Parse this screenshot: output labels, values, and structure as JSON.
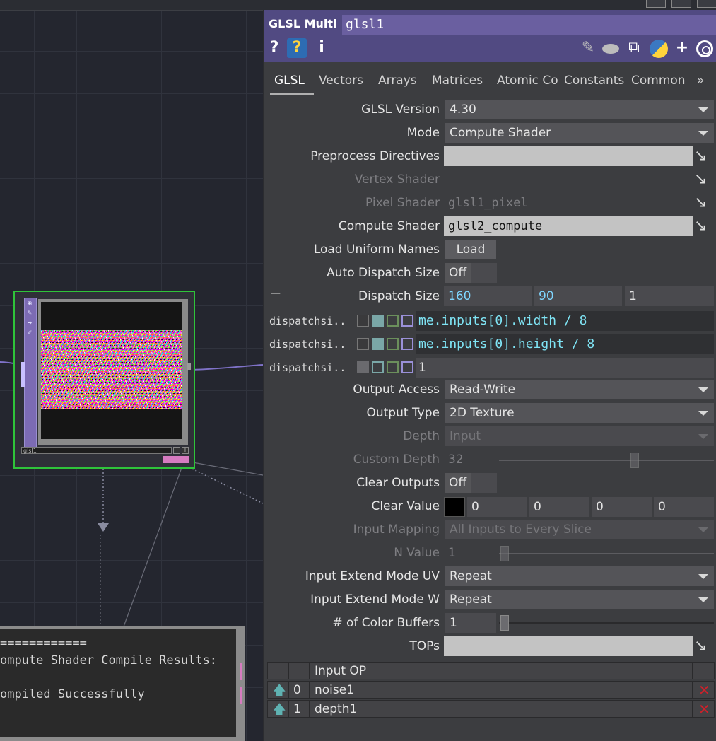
{
  "window_controls": [
    "minimize",
    "restore",
    "menu"
  ],
  "node": {
    "name": "glsl1"
  },
  "textport": {
    "lines": [
      "============",
      "ompute Shader Compile Results:",
      "",
      "ompiled Successfully"
    ]
  },
  "header": {
    "op_type": "GLSL Multi",
    "op_name": "glsl1",
    "icons": [
      "help-icon",
      "python-help-icon",
      "info-icon",
      "edit-icon",
      "comment-icon",
      "clone-icon",
      "python-icon",
      "add-icon",
      "viewer-icon"
    ],
    "help_label": "?",
    "info_label": "i"
  },
  "tabs": [
    "GLSL",
    "Vectors",
    "Arrays",
    "Matrices",
    "Atomic Co",
    "Constants",
    "Common",
    "»"
  ],
  "params": {
    "glsl_version": {
      "label": "GLSL Version",
      "value": "4.30"
    },
    "mode": {
      "label": "Mode",
      "value": "Compute Shader"
    },
    "preprocess": {
      "label": "Preprocess Directives",
      "value": ""
    },
    "vertex_shader": {
      "label": "Vertex Shader",
      "value": ""
    },
    "pixel_shader": {
      "label": "Pixel Shader",
      "value": "glsl1_pixel"
    },
    "compute_shader": {
      "label": "Compute Shader",
      "value": "glsl2_compute"
    },
    "load_uniform": {
      "label": "Load Uniform Names",
      "button": "Load"
    },
    "auto_dispatch": {
      "label": "Auto Dispatch Size",
      "value": "Off"
    },
    "dispatch_size": {
      "label": "Dispatch Size",
      "collapse": "—",
      "values": [
        "160",
        "90",
        "1"
      ]
    },
    "dispatch_rows": [
      {
        "label": "dispatchsi..",
        "expr": "me.inputs[0].width / 8"
      },
      {
        "label": "dispatchsi..",
        "expr": "me.inputs[0].height / 8"
      },
      {
        "label": "dispatchsi..",
        "expr": "1"
      }
    ],
    "output_access": {
      "label": "Output Access",
      "value": "Read-Write"
    },
    "output_type": {
      "label": "Output Type",
      "value": "2D Texture"
    },
    "depth": {
      "label": "Depth",
      "value": "Input"
    },
    "custom_depth": {
      "label": "Custom Depth",
      "value": "32"
    },
    "clear_outputs": {
      "label": "Clear Outputs",
      "value": "Off"
    },
    "clear_value": {
      "label": "Clear Value",
      "values": [
        "0",
        "0",
        "0",
        "0"
      ],
      "swatch": "#000000"
    },
    "input_mapping": {
      "label": "Input Mapping",
      "value": "All Inputs to Every Slice"
    },
    "n_value": {
      "label": "N Value",
      "value": "1"
    },
    "extend_uv": {
      "label": "Input Extend Mode UV",
      "value": "Repeat"
    },
    "extend_w": {
      "label": "Input Extend Mode W",
      "value": "Repeat"
    },
    "color_buffers": {
      "label": "# of Color Buffers",
      "value": "1"
    },
    "tops": {
      "label": "TOPs",
      "value": ""
    }
  },
  "input_table": {
    "header": "Input OP",
    "rows": [
      {
        "index": "0",
        "op": "noise1"
      },
      {
        "index": "1",
        "op": "depth1"
      }
    ]
  },
  "colors": {
    "panel_bg": "#3c3d40",
    "header_bg": "#514a82",
    "node_select": "#2fc43a",
    "delete": "#d0202a",
    "expr_text": "#7fe4f5"
  }
}
